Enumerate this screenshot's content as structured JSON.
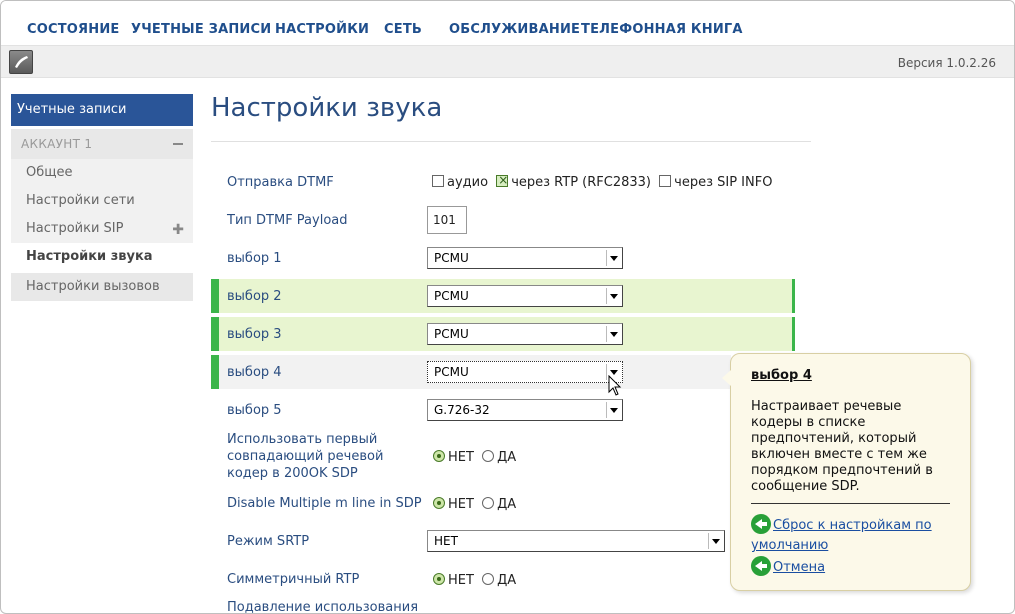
{
  "nav": {
    "items": [
      "СОСТОЯНИЕ",
      "УЧЕТНЫЕ ЗАПИСИ",
      "НАСТРОЙКИ",
      "СЕТЬ",
      "ОБСЛУЖИВАНИЕ",
      "ТЕЛЕФОННАЯ КНИГА"
    ]
  },
  "subbar": {
    "version": "Версия 1.0.2.26",
    "logo_icon": "phone-handset-icon"
  },
  "sidebar": {
    "header": "Учетные записи",
    "account": "АККАУНТ 1",
    "items": [
      "Общее",
      "Настройки сети",
      "Настройки SIP",
      "Настройки звука",
      "Настройки вызовов"
    ]
  },
  "page": {
    "title": "Настройки звука"
  },
  "form": {
    "dtmf": {
      "label": "Отправка DTMF",
      "options": [
        {
          "label": "аудио",
          "checked": false
        },
        {
          "label": "через RTP (RFC2833)",
          "checked": true
        },
        {
          "label": "через SIP INFO",
          "checked": false
        }
      ]
    },
    "payload": {
      "label": "Тип DTMF Payload",
      "value": "101"
    },
    "choice1": {
      "label": "выбор 1",
      "value": "PCMU"
    },
    "choice2": {
      "label": "выбор 2",
      "value": "PCMU"
    },
    "choice3": {
      "label": "выбор 3",
      "value": "PCMU"
    },
    "choice4": {
      "label": "выбор 4",
      "value": "PCMU"
    },
    "choice5": {
      "label": "выбор 5",
      "value": "G.726-32"
    },
    "first_codec": {
      "label": "Использовать первый совпадающий речевой кодер в 200OK SDP",
      "no": "НЕТ",
      "yes": "ДА",
      "selected": "no"
    },
    "disable_mline": {
      "label": "Disable Multiple m line in SDP",
      "no": "НЕТ",
      "yes": "ДА",
      "selected": "no"
    },
    "srtp": {
      "label": "Режим SRTP",
      "value": "НЕТ"
    },
    "sym_rtp": {
      "label": "Симметричный RTP",
      "no": "НЕТ",
      "yes": "ДА",
      "selected": "no"
    },
    "suppress": {
      "label": "Подавление использования"
    }
  },
  "tooltip": {
    "title": "выбор 4",
    "body": "Настраивает речевые кодеры в списке предпочтений, который включен вместе с тем же порядком предпочтений в сообщение SDP.",
    "reset_link": "Сброс к настройкам по умолчанию",
    "cancel_link": "Отмена"
  },
  "colors": {
    "nav_text": "#1f4e8c",
    "sidebar_header": "#2a5598",
    "highlight_row": "#e8f5d0",
    "accent_green": "#3bb54a"
  }
}
